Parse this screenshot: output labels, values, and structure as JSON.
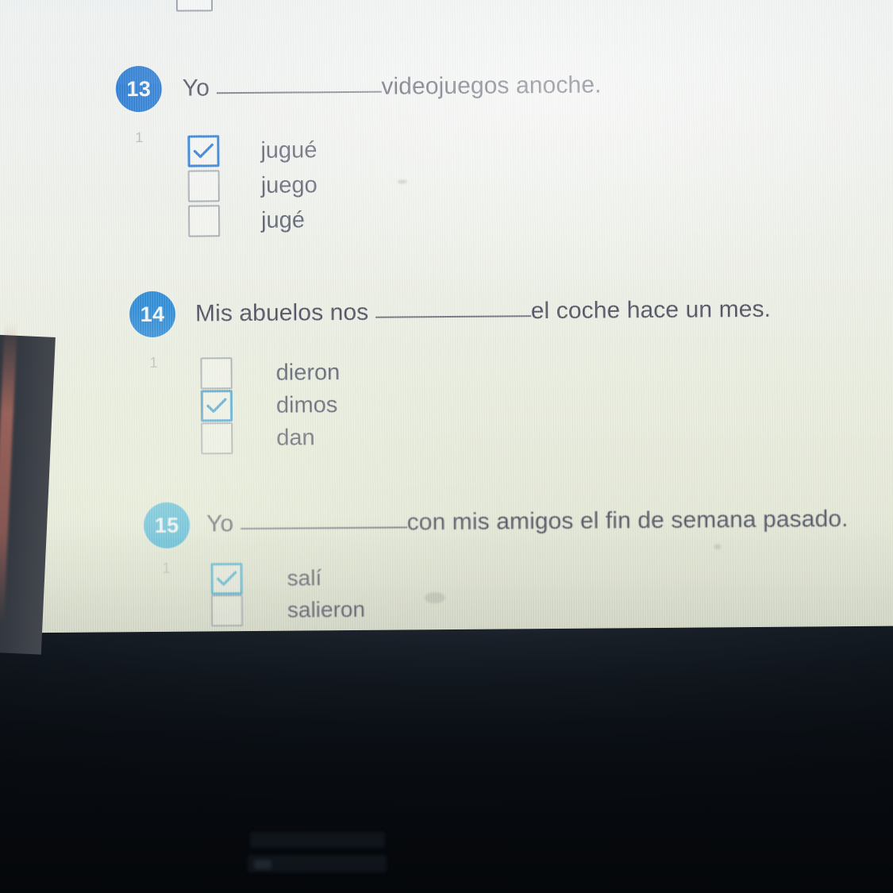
{
  "quiz": {
    "questions": [
      {
        "number": "13",
        "points": "1",
        "text_before": "Yo",
        "text_after": "videojuegos anoche.",
        "badge_color": "#2b7cd3",
        "options": [
          {
            "label": "jugué",
            "checked": true
          },
          {
            "label": "juego",
            "checked": false
          },
          {
            "label": "jugé",
            "checked": false
          }
        ]
      },
      {
        "number": "14",
        "points": "1",
        "text_before": "Mis abuelos nos",
        "text_after": "el coche hace un mes.",
        "badge_color": "#2b8ad6",
        "options": [
          {
            "label": "dieron",
            "checked": false
          },
          {
            "label": "dimos",
            "checked": true
          },
          {
            "label": "dan",
            "checked": false
          }
        ]
      },
      {
        "number": "15",
        "points": "1",
        "text_before": "Yo",
        "text_after": "con mis amigos el fin de semana pasado.",
        "badge_color": "#3aaed8",
        "options": [
          {
            "label": "salí",
            "checked": true
          },
          {
            "label": "salieron",
            "checked": false
          }
        ]
      }
    ]
  },
  "palette": {
    "screen_top": "#eef1f1",
    "screen_bottom": "#e2e6d4",
    "question_text": "#4a4d5c",
    "option_text": "#54586a",
    "checkbox_unchecked_border": "#a6abb1",
    "checkbox_checked_blue": "#2b7cd3",
    "checkbox_checked_cyan": "#4a9fcf",
    "points_text": "#b9bdb6",
    "laptop_body": "#121820"
  },
  "icons": {
    "checkmark": "check-icon"
  }
}
